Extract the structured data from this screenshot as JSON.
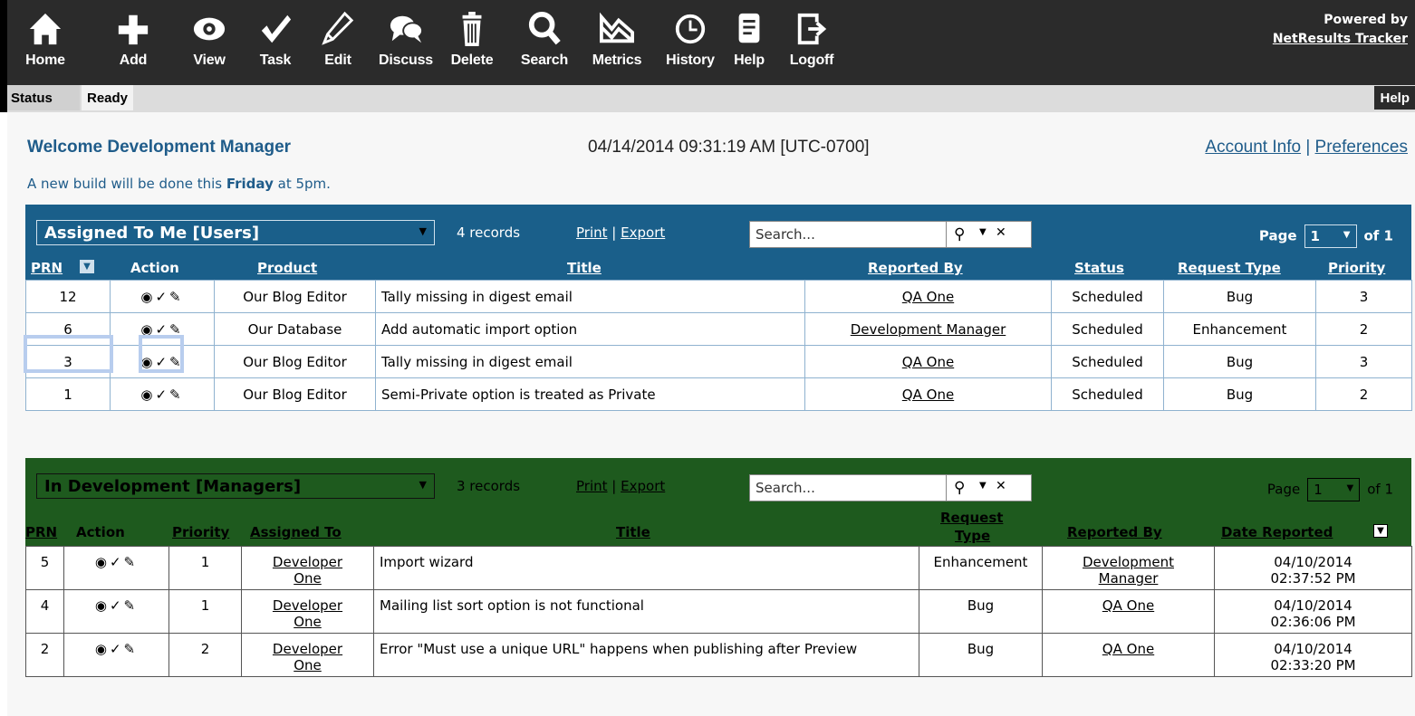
{
  "toolbar": {
    "buttons": [
      {
        "label": "Home",
        "icon": "home-icon"
      },
      {
        "label": "Add",
        "icon": "plus-icon"
      },
      {
        "label": "View",
        "icon": "eye-icon"
      },
      {
        "label": "Task",
        "icon": "check-icon"
      },
      {
        "label": "Edit",
        "icon": "pencil-icon"
      },
      {
        "label": "Discuss",
        "icon": "chat-icon"
      },
      {
        "label": "Delete",
        "icon": "trash-icon"
      },
      {
        "label": "Search",
        "icon": "magnifier-icon"
      },
      {
        "label": "Metrics",
        "icon": "chart-icon"
      },
      {
        "label": "History",
        "icon": "clock-icon"
      },
      {
        "label": "Help",
        "icon": "document-icon"
      },
      {
        "label": "Logoff",
        "icon": "logoff-icon"
      }
    ],
    "powered_by": "Powered by",
    "product": "NetResults Tracker"
  },
  "status": {
    "label": "Status",
    "value": "Ready",
    "help": "Help"
  },
  "welcome": "Welcome Development Manager",
  "datetime": "04/14/2014 09:31:19 AM [UTC-0700]",
  "account_info": "Account Info",
  "separator": "|",
  "preferences": "Preferences",
  "notice": {
    "pre": "A new build will be done this ",
    "bold": "Friday",
    "post": " at 5pm."
  },
  "panel1": {
    "view": "Assigned To Me [Users]",
    "records": "4 records",
    "print": "Print",
    "export": "Export",
    "search_placeholder": "Search...",
    "page_label": "Page",
    "page": "1",
    "of": "of 1",
    "columns": {
      "prn": "PRN",
      "action": "Action",
      "product": "Product",
      "title": "Title",
      "reported_by": "Reported By",
      "status": "Status",
      "request_type": "Request Type",
      "priority": "Priority"
    },
    "rows": [
      {
        "prn": "12",
        "product": "Our Blog Editor",
        "title": "Tally missing in digest email",
        "reported_by": "QA One",
        "status": "Scheduled",
        "type": "Bug",
        "priority": "3"
      },
      {
        "prn": "6",
        "product": "Our Database",
        "title": "Add automatic import option",
        "reported_by": "Development Manager",
        "status": "Scheduled",
        "type": "Enhancement",
        "priority": "2"
      },
      {
        "prn": "3",
        "product": "Our Blog Editor",
        "title": "Tally missing in digest email",
        "reported_by": "QA One",
        "status": "Scheduled",
        "type": "Bug",
        "priority": "3"
      },
      {
        "prn": "1",
        "product": "Our Blog Editor",
        "title": "Semi-Private option is treated as Private",
        "reported_by": "QA One",
        "status": "Scheduled",
        "type": "Bug",
        "priority": "2"
      }
    ]
  },
  "panel2": {
    "view": "In Development [Managers]",
    "records": "3 records",
    "print": "Print",
    "export": "Export",
    "search_placeholder": "Search...",
    "page_label": "Page",
    "page": "1",
    "of": "of 1",
    "columns": {
      "prn": "PRN",
      "action": "Action",
      "priority": "Priority",
      "assigned_to": "Assigned To",
      "title": "Title",
      "request_type_1": "Request",
      "request_type_2": "Type",
      "reported_by": "Reported By",
      "date_reported": "Date Reported"
    },
    "rows": [
      {
        "prn": "5",
        "priority": "1",
        "assigned_1": "Developer",
        "assigned_2": "One",
        "title": "Import wizard",
        "type": "Enhancement",
        "reported_1": "Development",
        "reported_2": "Manager",
        "date": "04/10/2014",
        "time": "02:37:52 PM"
      },
      {
        "prn": "4",
        "priority": "1",
        "assigned_1": "Developer",
        "assigned_2": "One",
        "title": "Mailing list sort option is not functional",
        "type": "Bug",
        "reported_1": "QA One",
        "reported_2": "",
        "date": "04/10/2014",
        "time": "02:36:06 PM"
      },
      {
        "prn": "2",
        "priority": "2",
        "assigned_1": "Developer",
        "assigned_2": "One",
        "title": "Error \"Must use a unique URL\" happens when publishing after Preview",
        "type": "Bug",
        "reported_1": "QA One",
        "reported_2": "",
        "date": "04/10/2014",
        "time": "02:33:20 PM"
      }
    ]
  }
}
